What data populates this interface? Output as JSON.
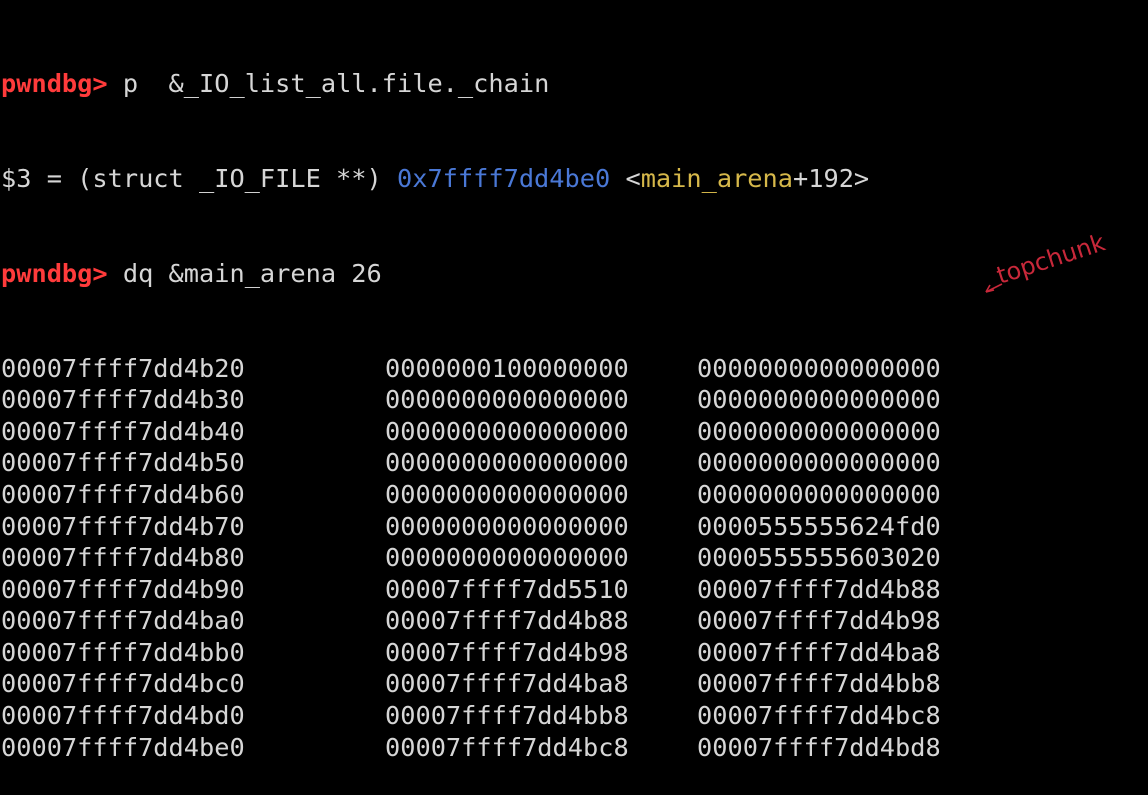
{
  "prompt": "pwndbg>",
  "cmd1": " p  &_IO_list_all.file._chain",
  "result": {
    "prefix": "$3 = (struct _IO_FILE **) ",
    "address": "0x7ffff7dd4be0",
    "space": " <",
    "symbol": "main_arena",
    "suffix": "+192>"
  },
  "cmd2": " dq &main_arena 26",
  "rows": [
    {
      "addr": "00007ffff7dd4b20",
      "v1": "0000000100000000",
      "v2": "0000000000000000"
    },
    {
      "addr": "00007ffff7dd4b30",
      "v1": "0000000000000000",
      "v2": "0000000000000000"
    },
    {
      "addr": "00007ffff7dd4b40",
      "v1": "0000000000000000",
      "v2": "0000000000000000"
    },
    {
      "addr": "00007ffff7dd4b50",
      "v1": "0000000000000000",
      "v2": "0000000000000000"
    },
    {
      "addr": "00007ffff7dd4b60",
      "v1": "0000000000000000",
      "v2": "0000000000000000"
    },
    {
      "addr": "00007ffff7dd4b70",
      "v1": "0000000000000000",
      "v2": "0000555555624fd0"
    },
    {
      "addr": "00007ffff7dd4b80",
      "v1": "0000000000000000",
      "v2": "0000555555603020"
    },
    {
      "addr": "00007ffff7dd4b90",
      "v1": "00007ffff7dd5510",
      "v2": "00007ffff7dd4b88"
    },
    {
      "addr": "00007ffff7dd4ba0",
      "v1": "00007ffff7dd4b88",
      "v2": "00007ffff7dd4b98"
    },
    {
      "addr": "00007ffff7dd4bb0",
      "v1": "00007ffff7dd4b98",
      "v2": "00007ffff7dd4ba8"
    },
    {
      "addr": "00007ffff7dd4bc0",
      "v1": "00007ffff7dd4ba8",
      "v2": "00007ffff7dd4bb8"
    },
    {
      "addr": "00007ffff7dd4bd0",
      "v1": "00007ffff7dd4bb8",
      "v2": "00007ffff7dd4bc8"
    },
    {
      "addr": "00007ffff7dd4be0",
      "v1": "00007ffff7dd4bc8",
      "v2": "00007ffff7dd4bd8"
    }
  ],
  "annotation_text": "topchunk",
  "colors": {
    "background": "#000000",
    "text": "#d6d6d6",
    "prompt": "#ff3b3b",
    "address": "#4a78d6",
    "symbol": "#d6b84a",
    "annotation": "#c8283a"
  }
}
